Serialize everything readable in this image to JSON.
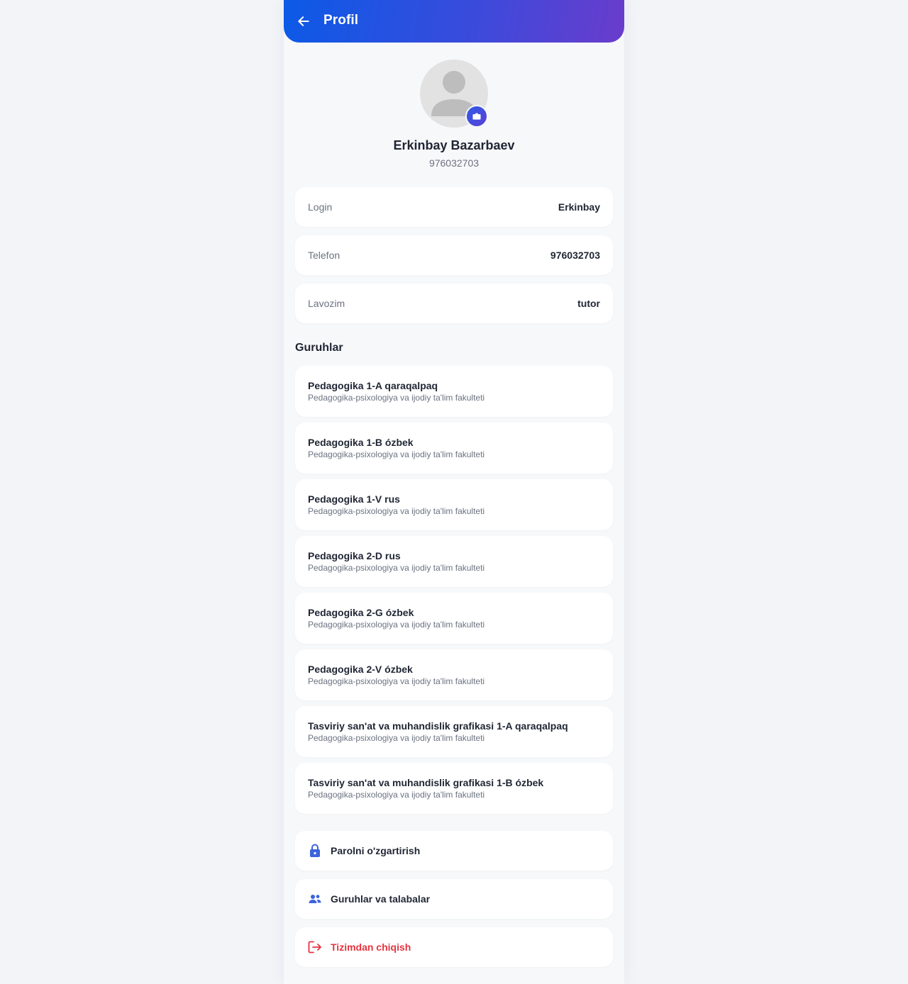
{
  "header": {
    "title": "Profil",
    "back_icon": "arrow-left-icon"
  },
  "profile": {
    "name": "Erkinbay Bazarbaev",
    "phone": "976032703",
    "avatar_icon": "user-placeholder-icon",
    "camera_icon": "camera-icon"
  },
  "info": [
    {
      "label": "Login",
      "value": "Erkinbay"
    },
    {
      "label": "Telefon",
      "value": "976032703"
    },
    {
      "label": "Lavozim",
      "value": "tutor"
    }
  ],
  "groups_title": "Guruhlar",
  "groups": [
    {
      "name": "Pedagogika 1-A qaraqalpaq",
      "faculty": "Pedagogika-psixologiya va ijodiy ta'lim fakulteti"
    },
    {
      "name": "Pedagogika 1-B ózbek",
      "faculty": "Pedagogika-psixologiya va ijodiy ta'lim fakulteti"
    },
    {
      "name": "Pedagogika 1-V rus",
      "faculty": "Pedagogika-psixologiya va ijodiy ta'lim fakulteti"
    },
    {
      "name": "Pedagogika 2-D rus",
      "faculty": "Pedagogika-psixologiya va ijodiy ta'lim fakulteti"
    },
    {
      "name": "Pedagogika 2-G ózbek",
      "faculty": "Pedagogika-psixologiya va ijodiy ta'lim fakulteti"
    },
    {
      "name": "Pedagogika 2-V ózbek",
      "faculty": "Pedagogika-psixologiya va ijodiy ta'lim fakulteti"
    },
    {
      "name": "Tasviriy san'at va muhandislik grafikasi 1-A qaraqalpaq",
      "faculty": "Pedagogika-psixologiya va ijodiy ta'lim fakulteti"
    },
    {
      "name": "Tasviriy san'at va muhandislik grafikasi 1-B ózbek",
      "faculty": "Pedagogika-psixologiya va ijodiy ta'lim fakulteti"
    }
  ],
  "actions": [
    {
      "label": "Parolni o'zgartirish",
      "icon": "lock-icon"
    },
    {
      "label": "Guruhlar va talabalar",
      "icon": "people-icon"
    },
    {
      "label": "Tizimdan chiqish",
      "icon": "logout-icon"
    }
  ],
  "colors": {
    "header_gradient_start": "#0b5ae6",
    "header_gradient_end": "#6a3ccc",
    "accent": "#3d63dd",
    "danger": "#e5343f",
    "background": "#f7f8fa"
  }
}
